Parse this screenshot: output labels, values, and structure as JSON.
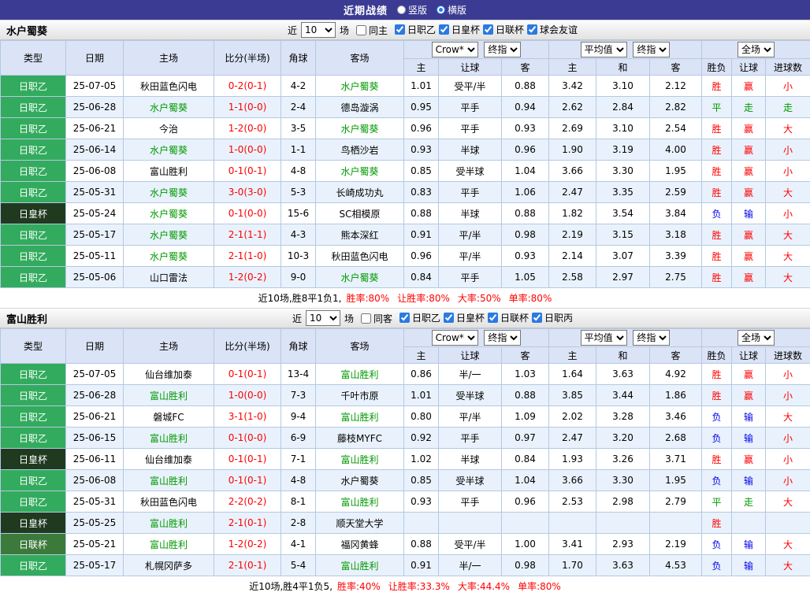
{
  "topbar": {
    "title": "近期战绩",
    "options": [
      {
        "label": "竖版",
        "selected": false
      },
      {
        "label": "横版",
        "selected": true
      }
    ]
  },
  "colors": {
    "topbar_bg": "#3b3b94",
    "league_j2_badge": "#33ab5e",
    "emperor_cup_badge": "#1f3a1f",
    "league_cup_badge": "#3c7a3c",
    "focus_team_green": "#009900",
    "win_red": "#ff0000",
    "lose_blue": "#0000ee",
    "header_bg": "#dbe3f6",
    "alt_row_bg": "#e9f2fc"
  },
  "sections": [
    {
      "team": "水户蜀葵",
      "filter": {
        "near_label": "近",
        "count": "10",
        "games_label": "场",
        "same_label": "同主",
        "same_checked": false,
        "leagues": [
          "日职乙",
          "日皇杯",
          "日联杯",
          "球会友谊"
        ]
      },
      "header": {
        "col_type": "类型",
        "col_date": "日期",
        "col_home": "主场",
        "col_score": "比分(半场)",
        "col_corner": "角球",
        "col_away": "客场",
        "dd_company": "Crow*",
        "dd_final1": "终指",
        "dd_avg": "平均值",
        "dd_final2": "终指",
        "dd_full": "全场",
        "sub": [
          "主",
          "让球",
          "客",
          "主",
          "和",
          "客",
          "胜负",
          "让球",
          "进球数"
        ]
      },
      "rows": [
        {
          "type": "日职乙",
          "date": "25-07-05",
          "home": "秋田蓝色闪电",
          "home_hl": false,
          "score": "0-2(0-1)",
          "corner": "4-2",
          "away": "水户蜀葵",
          "away_hl": true,
          "o1": "1.01",
          "hcp": "受平/半",
          "o2": "0.88",
          "a1": "3.42",
          "a2": "3.10",
          "a3": "2.12",
          "r1": "胜",
          "r1c": "r",
          "r2": "赢",
          "r2c": "r",
          "r3": "小",
          "r3c": "r"
        },
        {
          "type": "日职乙",
          "date": "25-06-28",
          "home": "水户蜀葵",
          "home_hl": true,
          "score": "1-1(0-0)",
          "corner": "2-4",
          "away": "德岛漩涡",
          "away_hl": false,
          "o1": "0.95",
          "hcp": "平手",
          "o2": "0.94",
          "a1": "2.62",
          "a2": "2.84",
          "a3": "2.82",
          "r1": "平",
          "r1c": "g",
          "r2": "走",
          "r2c": "g",
          "r3": "走",
          "r3c": "g"
        },
        {
          "type": "日职乙",
          "date": "25-06-21",
          "home": "今治",
          "home_hl": false,
          "score": "1-2(0-0)",
          "corner": "3-5",
          "away": "水户蜀葵",
          "away_hl": true,
          "o1": "0.96",
          "hcp": "平手",
          "o2": "0.93",
          "a1": "2.69",
          "a2": "3.10",
          "a3": "2.54",
          "r1": "胜",
          "r1c": "r",
          "r2": "赢",
          "r2c": "r",
          "r3": "大",
          "r3c": "r"
        },
        {
          "type": "日职乙",
          "date": "25-06-14",
          "home": "水户蜀葵",
          "home_hl": true,
          "score": "1-0(0-0)",
          "corner": "1-1",
          "away": "鸟栖沙岩",
          "away_hl": false,
          "o1": "0.93",
          "hcp": "半球",
          "o2": "0.96",
          "a1": "1.90",
          "a2": "3.19",
          "a3": "4.00",
          "r1": "胜",
          "r1c": "r",
          "r2": "赢",
          "r2c": "r",
          "r3": "小",
          "r3c": "r"
        },
        {
          "type": "日职乙",
          "date": "25-06-08",
          "home": "富山胜利",
          "home_hl": false,
          "score": "0-1(0-1)",
          "corner": "4-8",
          "away": "水户蜀葵",
          "away_hl": true,
          "o1": "0.85",
          "hcp": "受半球",
          "o2": "1.04",
          "a1": "3.66",
          "a2": "3.30",
          "a3": "1.95",
          "r1": "胜",
          "r1c": "r",
          "r2": "赢",
          "r2c": "r",
          "r3": "小",
          "r3c": "r"
        },
        {
          "type": "日职乙",
          "date": "25-05-31",
          "home": "水户蜀葵",
          "home_hl": true,
          "score": "3-0(3-0)",
          "corner": "5-3",
          "away": "长崎成功丸",
          "away_hl": false,
          "o1": "0.83",
          "hcp": "平手",
          "o2": "1.06",
          "a1": "2.47",
          "a2": "3.35",
          "a3": "2.59",
          "r1": "胜",
          "r1c": "r",
          "r2": "赢",
          "r2c": "r",
          "r3": "大",
          "r3c": "r"
        },
        {
          "type": "日皇杯",
          "date": "25-05-24",
          "home": "水户蜀葵",
          "home_hl": true,
          "score": "0-1(0-0)",
          "corner": "15-6",
          "away": "SC相模原",
          "away_hl": false,
          "o1": "0.88",
          "hcp": "半球",
          "o2": "0.88",
          "a1": "1.82",
          "a2": "3.54",
          "a3": "3.84",
          "r1": "负",
          "r1c": "b",
          "r2": "输",
          "r2c": "b",
          "r3": "小",
          "r3c": "r"
        },
        {
          "type": "日职乙",
          "date": "25-05-17",
          "home": "水户蜀葵",
          "home_hl": true,
          "score": "2-1(1-1)",
          "corner": "4-3",
          "away": "熊本深红",
          "away_hl": false,
          "o1": "0.91",
          "hcp": "平/半",
          "o2": "0.98",
          "a1": "2.19",
          "a2": "3.15",
          "a3": "3.18",
          "r1": "胜",
          "r1c": "r",
          "r2": "赢",
          "r2c": "r",
          "r3": "大",
          "r3c": "r"
        },
        {
          "type": "日职乙",
          "date": "25-05-11",
          "home": "水户蜀葵",
          "home_hl": true,
          "score": "2-1(1-0)",
          "corner": "10-3",
          "away": "秋田蓝色闪电",
          "away_hl": false,
          "o1": "0.96",
          "hcp": "平/半",
          "o2": "0.93",
          "a1": "2.14",
          "a2": "3.07",
          "a3": "3.39",
          "r1": "胜",
          "r1c": "r",
          "r2": "赢",
          "r2c": "r",
          "r3": "大",
          "r3c": "r"
        },
        {
          "type": "日职乙",
          "date": "25-05-06",
          "home": "山口雷法",
          "home_hl": false,
          "score": "1-2(0-2)",
          "corner": "9-0",
          "away": "水户蜀葵",
          "away_hl": true,
          "o1": "0.84",
          "hcp": "平手",
          "o2": "1.05",
          "a1": "2.58",
          "a2": "2.97",
          "a3": "2.75",
          "r1": "胜",
          "r1c": "r",
          "r2": "赢",
          "r2c": "r",
          "r3": "大",
          "r3c": "r"
        }
      ],
      "footer": {
        "summary": "近10场,胜8平1负1,",
        "rates": [
          "胜率:80%",
          "让胜率:80%",
          "大率:50%",
          "单率:80%"
        ]
      }
    },
    {
      "team": "富山胜利",
      "filter": {
        "near_label": "近",
        "count": "10",
        "games_label": "场",
        "same_label": "同客",
        "same_checked": false,
        "leagues": [
          "日职乙",
          "日皇杯",
          "日联杯",
          "日职丙"
        ]
      },
      "header": {
        "col_type": "类型",
        "col_date": "日期",
        "col_home": "主场",
        "col_score": "比分(半场)",
        "col_corner": "角球",
        "col_away": "客场",
        "dd_company": "Crow*",
        "dd_final1": "终指",
        "dd_avg": "平均值",
        "dd_final2": "终指",
        "dd_full": "全场",
        "sub": [
          "主",
          "让球",
          "客",
          "主",
          "和",
          "客",
          "胜负",
          "让球",
          "进球数"
        ]
      },
      "rows": [
        {
          "type": "日职乙",
          "date": "25-07-05",
          "home": "仙台维加泰",
          "home_hl": false,
          "score": "0-1(0-1)",
          "corner": "13-4",
          "away": "富山胜利",
          "away_hl": true,
          "o1": "0.86",
          "hcp": "半/一",
          "o2": "1.03",
          "a1": "1.64",
          "a2": "3.63",
          "a3": "4.92",
          "r1": "胜",
          "r1c": "r",
          "r2": "赢",
          "r2c": "r",
          "r3": "小",
          "r3c": "r"
        },
        {
          "type": "日职乙",
          "date": "25-06-28",
          "home": "富山胜利",
          "home_hl": true,
          "score": "1-0(0-0)",
          "corner": "7-3",
          "away": "千叶市原",
          "away_hl": false,
          "o1": "1.01",
          "hcp": "受半球",
          "o2": "0.88",
          "a1": "3.85",
          "a2": "3.44",
          "a3": "1.86",
          "r1": "胜",
          "r1c": "r",
          "r2": "赢",
          "r2c": "r",
          "r3": "小",
          "r3c": "r"
        },
        {
          "type": "日职乙",
          "date": "25-06-21",
          "home": "磐城FC",
          "home_hl": false,
          "score": "3-1(1-0)",
          "corner": "9-4",
          "away": "富山胜利",
          "away_hl": true,
          "o1": "0.80",
          "hcp": "平/半",
          "o2": "1.09",
          "a1": "2.02",
          "a2": "3.28",
          "a3": "3.46",
          "r1": "负",
          "r1c": "b",
          "r2": "输",
          "r2c": "b",
          "r3": "大",
          "r3c": "r"
        },
        {
          "type": "日职乙",
          "date": "25-06-15",
          "home": "富山胜利",
          "home_hl": true,
          "score": "0-1(0-0)",
          "corner": "6-9",
          "away": "藤枝MYFC",
          "away_hl": false,
          "o1": "0.92",
          "hcp": "平手",
          "o2": "0.97",
          "a1": "2.47",
          "a2": "3.20",
          "a3": "2.68",
          "r1": "负",
          "r1c": "b",
          "r2": "输",
          "r2c": "b",
          "r3": "小",
          "r3c": "r"
        },
        {
          "type": "日皇杯",
          "date": "25-06-11",
          "home": "仙台维加泰",
          "home_hl": false,
          "score": "0-1(0-1)",
          "corner": "7-1",
          "away": "富山胜利",
          "away_hl": true,
          "o1": "1.02",
          "hcp": "半球",
          "o2": "0.84",
          "a1": "1.93",
          "a2": "3.26",
          "a3": "3.71",
          "r1": "胜",
          "r1c": "r",
          "r2": "赢",
          "r2c": "r",
          "r3": "小",
          "r3c": "r"
        },
        {
          "type": "日职乙",
          "date": "25-06-08",
          "home": "富山胜利",
          "home_hl": true,
          "score": "0-1(0-1)",
          "corner": "4-8",
          "away": "水户蜀葵",
          "away_hl": false,
          "o1": "0.85",
          "hcp": "受半球",
          "o2": "1.04",
          "a1": "3.66",
          "a2": "3.30",
          "a3": "1.95",
          "r1": "负",
          "r1c": "b",
          "r2": "输",
          "r2c": "b",
          "r3": "小",
          "r3c": "r"
        },
        {
          "type": "日职乙",
          "date": "25-05-31",
          "home": "秋田蓝色闪电",
          "home_hl": false,
          "score": "2-2(0-2)",
          "corner": "8-1",
          "away": "富山胜利",
          "away_hl": true,
          "o1": "0.93",
          "hcp": "平手",
          "o2": "0.96",
          "a1": "2.53",
          "a2": "2.98",
          "a3": "2.79",
          "r1": "平",
          "r1c": "g",
          "r2": "走",
          "r2c": "g",
          "r3": "大",
          "r3c": "r"
        },
        {
          "type": "日皇杯",
          "date": "25-05-25",
          "home": "富山胜利",
          "home_hl": true,
          "score": "2-1(0-1)",
          "corner": "2-8",
          "away": "顺天堂大学",
          "away_hl": false,
          "o1": "",
          "hcp": "",
          "o2": "",
          "a1": "",
          "a2": "",
          "a3": "",
          "r1": "胜",
          "r1c": "r",
          "r2": "",
          "r2c": "",
          "r3": "",
          "r3c": ""
        },
        {
          "type": "日联杯",
          "date": "25-05-21",
          "home": "富山胜利",
          "home_hl": true,
          "score": "1-2(0-2)",
          "corner": "4-1",
          "away": "福冈黄蜂",
          "away_hl": false,
          "o1": "0.88",
          "hcp": "受平/半",
          "o2": "1.00",
          "a1": "3.41",
          "a2": "2.93",
          "a3": "2.19",
          "r1": "负",
          "r1c": "b",
          "r2": "输",
          "r2c": "b",
          "r3": "大",
          "r3c": "r"
        },
        {
          "type": "日职乙",
          "date": "25-05-17",
          "home": "札幌冈萨多",
          "home_hl": false,
          "score": "2-1(0-1)",
          "corner": "5-4",
          "away": "富山胜利",
          "away_hl": true,
          "o1": "0.91",
          "hcp": "半/一",
          "o2": "0.98",
          "a1": "1.70",
          "a2": "3.63",
          "a3": "4.53",
          "r1": "负",
          "r1c": "b",
          "r2": "输",
          "r2c": "b",
          "r3": "大",
          "r3c": "r"
        }
      ],
      "footer": {
        "summary": "近10场,胜4平1负5,",
        "rates": [
          "胜率:40%",
          "让胜率:33.3%",
          "大率:44.4%",
          "单率:80%"
        ]
      }
    }
  ]
}
